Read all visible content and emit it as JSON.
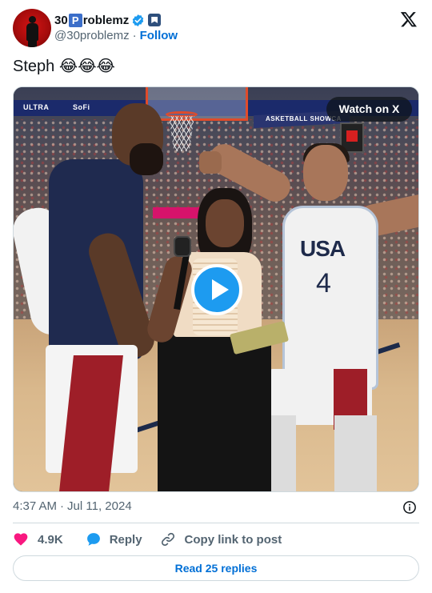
{
  "author": {
    "display_name_prefix": "30",
    "display_name_badge": "P",
    "display_name_suffix": "roblemz",
    "handle": "@30problemz",
    "separator": "·",
    "follow_label": "Follow"
  },
  "tweet": {
    "text": "Steph 😂😂😂"
  },
  "media": {
    "watch_label": "Watch on X",
    "jersey_text": "USA",
    "jersey_number": "4",
    "banner_left": "ULTRA",
    "banner_mid": "SoFi",
    "banner_right": "ASKETBALL SHOWCA"
  },
  "meta": {
    "time": "4:37 AM",
    "separator": "·",
    "date": "Jul 11, 2024"
  },
  "actions": {
    "like_count": "4.9K",
    "reply_label": "Reply",
    "copy_label": "Copy link to post"
  },
  "read_replies_label": "Read 25 replies",
  "colors": {
    "like": "#f91880",
    "reply": "#1d9bf0",
    "link": "#006fd6",
    "verified": "#1d9bf0",
    "muted": "#536471"
  }
}
